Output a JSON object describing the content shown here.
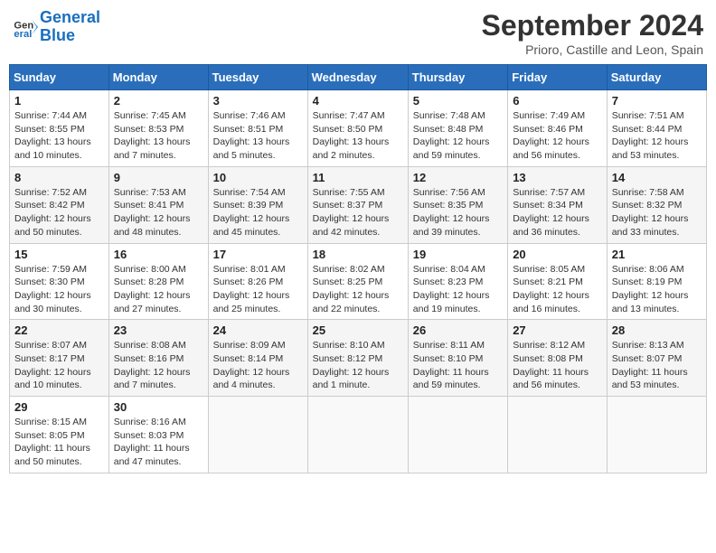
{
  "header": {
    "logo_line1": "General",
    "logo_line2": "Blue",
    "month_title": "September 2024",
    "location": "Prioro, Castille and Leon, Spain"
  },
  "days_of_week": [
    "Sunday",
    "Monday",
    "Tuesday",
    "Wednesday",
    "Thursday",
    "Friday",
    "Saturday"
  ],
  "weeks": [
    [
      {
        "day": "1",
        "sunrise": "7:44 AM",
        "sunset": "8:55 PM",
        "daylight": "13 hours and 10 minutes."
      },
      {
        "day": "2",
        "sunrise": "7:45 AM",
        "sunset": "8:53 PM",
        "daylight": "13 hours and 7 minutes."
      },
      {
        "day": "3",
        "sunrise": "7:46 AM",
        "sunset": "8:51 PM",
        "daylight": "13 hours and 5 minutes."
      },
      {
        "day": "4",
        "sunrise": "7:47 AM",
        "sunset": "8:50 PM",
        "daylight": "13 hours and 2 minutes."
      },
      {
        "day": "5",
        "sunrise": "7:48 AM",
        "sunset": "8:48 PM",
        "daylight": "12 hours and 59 minutes."
      },
      {
        "day": "6",
        "sunrise": "7:49 AM",
        "sunset": "8:46 PM",
        "daylight": "12 hours and 56 minutes."
      },
      {
        "day": "7",
        "sunrise": "7:51 AM",
        "sunset": "8:44 PM",
        "daylight": "12 hours and 53 minutes."
      }
    ],
    [
      {
        "day": "8",
        "sunrise": "7:52 AM",
        "sunset": "8:42 PM",
        "daylight": "12 hours and 50 minutes."
      },
      {
        "day": "9",
        "sunrise": "7:53 AM",
        "sunset": "8:41 PM",
        "daylight": "12 hours and 48 minutes."
      },
      {
        "day": "10",
        "sunrise": "7:54 AM",
        "sunset": "8:39 PM",
        "daylight": "12 hours and 45 minutes."
      },
      {
        "day": "11",
        "sunrise": "7:55 AM",
        "sunset": "8:37 PM",
        "daylight": "12 hours and 42 minutes."
      },
      {
        "day": "12",
        "sunrise": "7:56 AM",
        "sunset": "8:35 PM",
        "daylight": "12 hours and 39 minutes."
      },
      {
        "day": "13",
        "sunrise": "7:57 AM",
        "sunset": "8:34 PM",
        "daylight": "12 hours and 36 minutes."
      },
      {
        "day": "14",
        "sunrise": "7:58 AM",
        "sunset": "8:32 PM",
        "daylight": "12 hours and 33 minutes."
      }
    ],
    [
      {
        "day": "15",
        "sunrise": "7:59 AM",
        "sunset": "8:30 PM",
        "daylight": "12 hours and 30 minutes."
      },
      {
        "day": "16",
        "sunrise": "8:00 AM",
        "sunset": "8:28 PM",
        "daylight": "12 hours and 27 minutes."
      },
      {
        "day": "17",
        "sunrise": "8:01 AM",
        "sunset": "8:26 PM",
        "daylight": "12 hours and 25 minutes."
      },
      {
        "day": "18",
        "sunrise": "8:02 AM",
        "sunset": "8:25 PM",
        "daylight": "12 hours and 22 minutes."
      },
      {
        "day": "19",
        "sunrise": "8:04 AM",
        "sunset": "8:23 PM",
        "daylight": "12 hours and 19 minutes."
      },
      {
        "day": "20",
        "sunrise": "8:05 AM",
        "sunset": "8:21 PM",
        "daylight": "12 hours and 16 minutes."
      },
      {
        "day": "21",
        "sunrise": "8:06 AM",
        "sunset": "8:19 PM",
        "daylight": "12 hours and 13 minutes."
      }
    ],
    [
      {
        "day": "22",
        "sunrise": "8:07 AM",
        "sunset": "8:17 PM",
        "daylight": "12 hours and 10 minutes."
      },
      {
        "day": "23",
        "sunrise": "8:08 AM",
        "sunset": "8:16 PM",
        "daylight": "12 hours and 7 minutes."
      },
      {
        "day": "24",
        "sunrise": "8:09 AM",
        "sunset": "8:14 PM",
        "daylight": "12 hours and 4 minutes."
      },
      {
        "day": "25",
        "sunrise": "8:10 AM",
        "sunset": "8:12 PM",
        "daylight": "12 hours and 1 minute."
      },
      {
        "day": "26",
        "sunrise": "8:11 AM",
        "sunset": "8:10 PM",
        "daylight": "11 hours and 59 minutes."
      },
      {
        "day": "27",
        "sunrise": "8:12 AM",
        "sunset": "8:08 PM",
        "daylight": "11 hours and 56 minutes."
      },
      {
        "day": "28",
        "sunrise": "8:13 AM",
        "sunset": "8:07 PM",
        "daylight": "11 hours and 53 minutes."
      }
    ],
    [
      {
        "day": "29",
        "sunrise": "8:15 AM",
        "sunset": "8:05 PM",
        "daylight": "11 hours and 50 minutes."
      },
      {
        "day": "30",
        "sunrise": "8:16 AM",
        "sunset": "8:03 PM",
        "daylight": "11 hours and 47 minutes."
      },
      null,
      null,
      null,
      null,
      null
    ]
  ],
  "labels": {
    "sunrise": "Sunrise:",
    "sunset": "Sunset:",
    "daylight": "Daylight:"
  }
}
